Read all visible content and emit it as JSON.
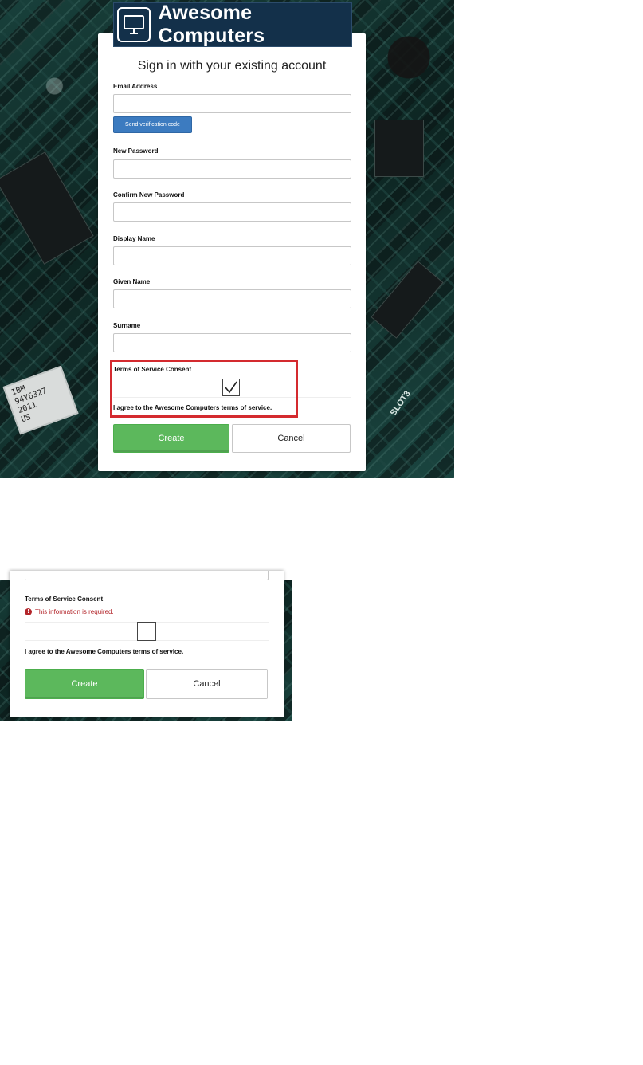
{
  "brand": {
    "name": "Awesome Computers",
    "icon": "monitor-icon",
    "bg_color": "#13304a"
  },
  "form": {
    "heading": "Sign in with your existing account",
    "email_label": "Email Address",
    "verify_button": "Send verification code",
    "new_password_label": "New Password",
    "confirm_password_label": "Confirm New Password",
    "display_name_label": "Display Name",
    "given_name_label": "Given Name",
    "surname_label": "Surname",
    "tos_label": "Terms of Service Consent",
    "tos_agree_text": "I agree to the Awesome Computers terms of service.",
    "tos_checked": true,
    "create_button": "Create",
    "cancel_button": "Cancel"
  },
  "error_view": {
    "tos_label": "Terms of Service Consent",
    "error_message": "This information is required.",
    "error_icon": "exclamation-circle-icon",
    "tos_agree_text": "I agree to the Awesome Computers terms of service.",
    "tos_checked": false,
    "create_button": "Create",
    "cancel_button": "Cancel"
  },
  "colors": {
    "create_green": "#5cb85c",
    "verify_blue": "#3c7bc0",
    "highlight_red": "#d42a2f",
    "error_red": "#b3262b"
  },
  "board_labels": {
    "chip_label": "IBM\n94Y6327\n2011\nUS",
    "slot_label": "SLOT3"
  }
}
